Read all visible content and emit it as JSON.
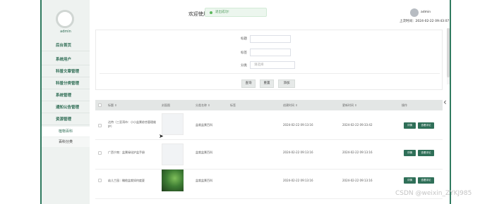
{
  "sidebar": {
    "user": "admin",
    "items": [
      {
        "label": "后台首页"
      },
      {
        "label": "系统用户"
      },
      {
        "label": "科普文章管理"
      },
      {
        "label": "科普分类管理"
      },
      {
        "label": "系统管理"
      },
      {
        "label": "通知公告管理"
      },
      {
        "label": "资源管理"
      }
    ],
    "subitems": [
      {
        "label": "植物百科"
      },
      {
        "label": "百科分类"
      }
    ]
  },
  "header": {
    "welcome": "欢迎使用",
    "toast": "退出成功!",
    "user": "admin",
    "login_time": "上次时间：2024-02-22 09:43:07"
  },
  "search": {
    "fields": [
      {
        "label": "标题",
        "placeholder": ""
      },
      {
        "label": "标签",
        "placeholder": ""
      },
      {
        "label": "分类",
        "placeholder": "请选择"
      }
    ],
    "buttons": {
      "query": "查询",
      "reset": "重置",
      "export": "添加"
    }
  },
  "table": {
    "headers": [
      "标题 ⇕",
      "封面图",
      "分类名称 ⇕",
      "标签",
      "创建时间 ⇕",
      "更新时间 ⇕",
      "操作"
    ],
    "rows": [
      {
        "title": "达特（三亚湾市：小小盆景综合管理维护）",
        "category": "盆栽盆景百科",
        "tag": "",
        "created": "2024-02-22 09:13:16",
        "updated": "2024-02-22 09:33:42",
        "detail": "详情",
        "comment": "查看评论",
        "image": "blank"
      },
      {
        "title": "广西宁南：盆景绿化护盆手册",
        "category": "盆栽盆景百科",
        "tag": "",
        "created": "2024-02-22 09:13:16",
        "updated": "2024-02-22 09:13:16",
        "detail": "详情",
        "comment": "查看评论",
        "image": "blank"
      },
      {
        "title": "幼儿兰园｜橄榄盆栽如何度夏",
        "category": "盆栽盆景百科",
        "tag": "",
        "created": "2024-02-22 09:13:16",
        "updated": "2024-02-22 09:13:16",
        "detail": "详情",
        "comment": "查看评论",
        "image": "plant"
      }
    ]
  },
  "watermark": "CSDN @weixin_ZYKJ985",
  "colors": {
    "accent": "#2f6f58",
    "sidebar_bg": "#eef2f0",
    "toast_bg": "#ecf6ee"
  }
}
